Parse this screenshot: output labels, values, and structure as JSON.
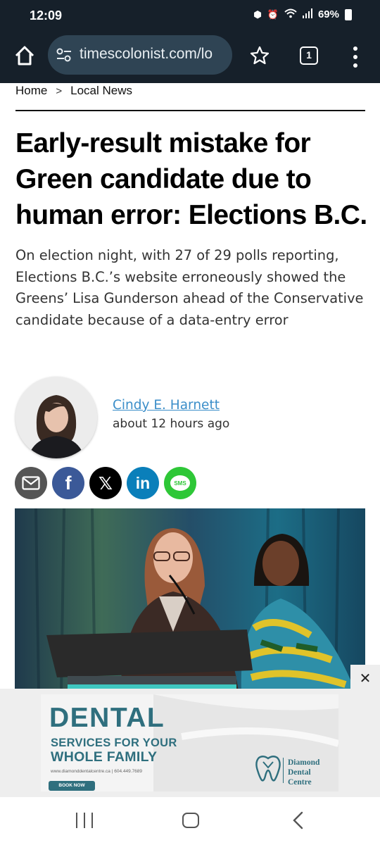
{
  "status_bar": {
    "time": "12:09",
    "battery": "69%"
  },
  "browser": {
    "url": "timescolonist.com/lo",
    "tab_count": "1"
  },
  "breadcrumb": {
    "home": "Home",
    "separator": ">",
    "section": "Local News"
  },
  "article": {
    "headline": "Early-result mistake for Green candidate due to human error: Elections B.C.",
    "dek": "On election night, with 27 of 29 polls reporting, Elections B.C.’s website erroneously showed the Greens’ Lisa Gunderson ahead of the Conservative candidate because of a data-entry error",
    "author": "Cindy E. Harnett",
    "published": "about 12 hours ago"
  },
  "share": {
    "email": {
      "icon": "envelope-icon",
      "color": "#555555"
    },
    "facebook": {
      "label": "f",
      "color": "#3b5998"
    },
    "x": {
      "label": "𝕏",
      "color": "#000000"
    },
    "linkedin": {
      "label": "in",
      "color": "#0a7fba"
    },
    "sms": {
      "label": "SMS",
      "color": "#2ec737"
    }
  },
  "ad": {
    "close_label": "✕",
    "title": "DENTAL",
    "line1": "SERVICES FOR YOUR",
    "line2": "WHOLE FAMILY",
    "website": "www.diamonddentalcentre.ca | 604.449.7689",
    "cta": "BOOK NOW",
    "brand": "Diamond\nDental\nCentre",
    "accent": "#2f6f7e"
  }
}
